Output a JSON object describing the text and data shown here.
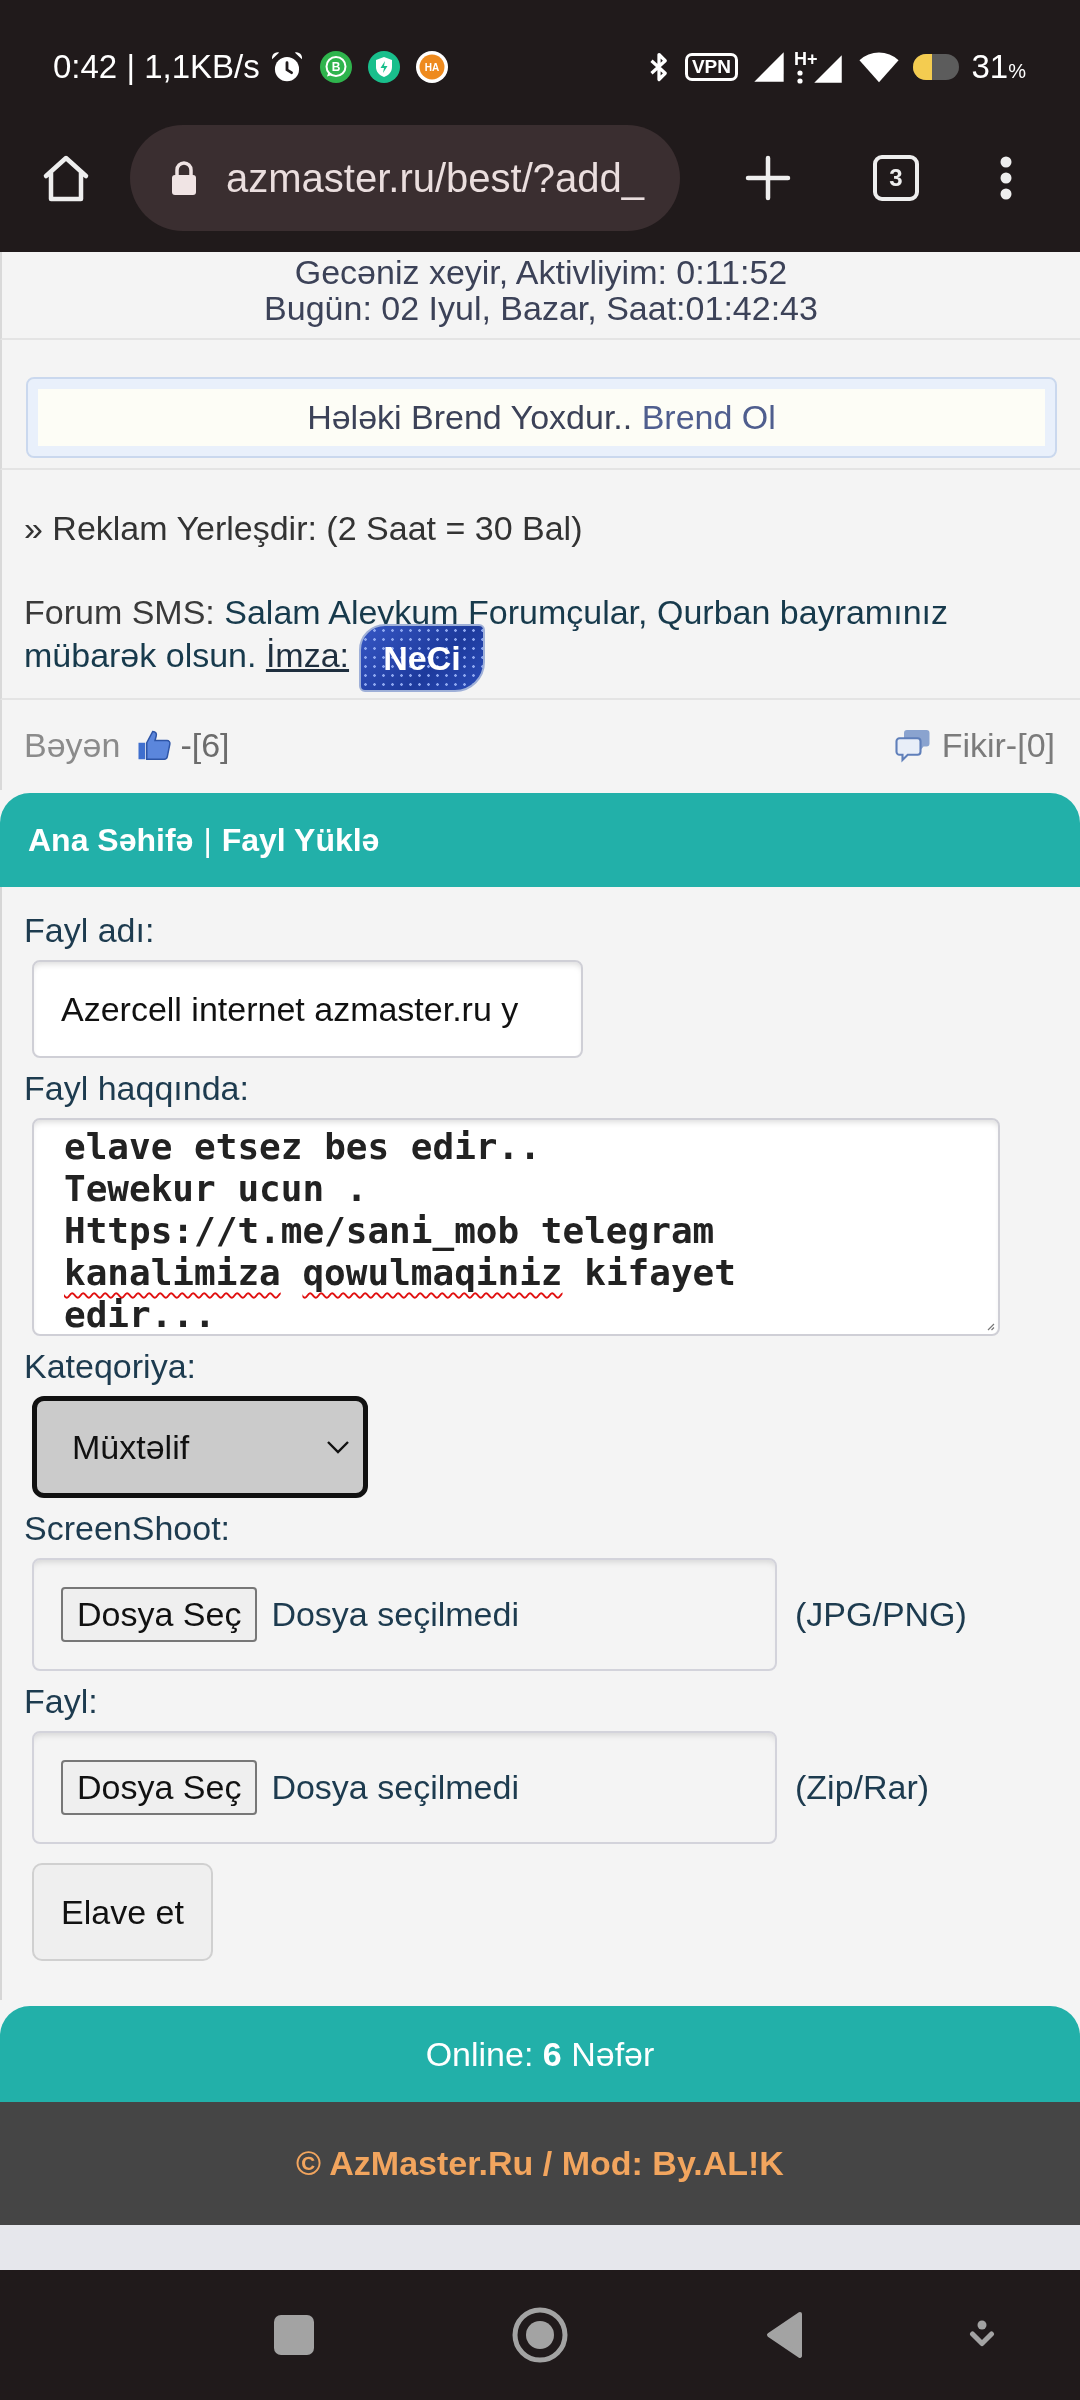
{
  "status_bar": {
    "time": "0:42 | 1,1KB/s",
    "notifications": [
      {
        "kind": "bubble",
        "glyph": "B",
        "color": "#2fb44d"
      },
      {
        "kind": "shield",
        "color": "#19bf8c"
      },
      {
        "kind": "coin",
        "glyph": "HA",
        "color": "#ee8a1e"
      }
    ],
    "vpn": "VPN",
    "network_type": "H+",
    "battery": "31",
    "battery_unit": "%"
  },
  "browser": {
    "url": "azmaster.ru/best/?add_",
    "tab_count": "3"
  },
  "info": {
    "lines": [
      "Gecəniz xeyir, Aktivliyim: 0:11:52",
      "Bugün: 02 Iyul, Bazar, Saat:01:42:43"
    ]
  },
  "brand": {
    "text": "Hələki Brend Yoxdur..",
    "link": "Brend Ol"
  },
  "ad": "» Reklam Yerleşdir: (2 Saat = 30 Bal)",
  "forum_sms": {
    "label": "Forum SMS:",
    "message": "Salam Aleykum Forumçular, Qurban bayramınız mübarək olsun.",
    "signature_label": "İmza:",
    "signature": "NeCi"
  },
  "reactions": {
    "like_label": "Bəyən",
    "like_count": "-[6]",
    "comment": "Fikir-[0]"
  },
  "upload": {
    "breadcrumb": [
      "Ana Səhifə",
      "Fayl Yüklə"
    ],
    "separator": "|",
    "fields": [
      {
        "kind": "text",
        "label": "Fayl adı:",
        "value": "Azercell internet azmaster.ru y"
      },
      {
        "kind": "textarea",
        "label": "Fayl haqqında:",
        "lines": [
          {
            "words": [
              {
                "text": "elave",
                "misspelled": false
              },
              {
                "text": "etsez",
                "misspelled": false
              },
              {
                "text": "bes",
                "misspelled": false
              },
              {
                "text": "edir..",
                "misspelled": false
              }
            ]
          },
          {
            "words": [
              {
                "text": "Tewekur",
                "misspelled": false
              },
              {
                "text": "ucun",
                "misspelled": false
              },
              {
                "text": ".",
                "misspelled": false
              }
            ]
          },
          {
            "words": [
              {
                "text": "Https://t.me/sani_mob",
                "misspelled": false
              },
              {
                "text": "telegram",
                "misspelled": false
              }
            ]
          },
          {
            "words": [
              {
                "text": "kanalimiza",
                "misspelled": true
              },
              {
                "text": "qowulmaqiniz",
                "misspelled": true
              },
              {
                "text": "kifayet",
                "misspelled": false
              }
            ]
          },
          {
            "words": [
              {
                "text": "edir...",
                "misspelled": false
              }
            ]
          }
        ]
      },
      {
        "kind": "select",
        "label": "Kateqoriya:",
        "value": "Müxtəlif"
      },
      {
        "kind": "file",
        "label": "ScreenShoot:",
        "button": "Dosya Seç",
        "status": "Dosya seçilmedi",
        "hint": "(JPG/PNG)"
      },
      {
        "kind": "file",
        "label": "Fayl:",
        "button": "Dosya Seç",
        "status": "Dosya seçilmedi",
        "hint": "(Zip/Rar)"
      }
    ],
    "submit": "Elave et"
  },
  "online": "Online: **6** Nəfər",
  "footer": "© AzMaster.Ru / Mod: By.AL!K"
}
